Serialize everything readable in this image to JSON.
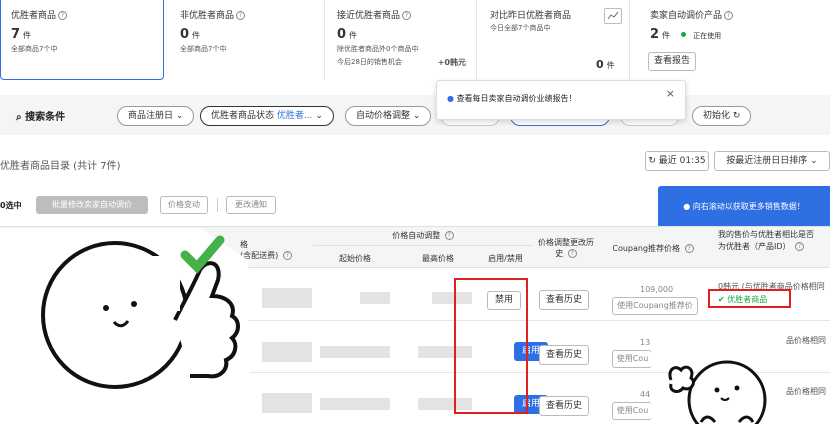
{
  "cards": [
    {
      "title": "优胜者商品",
      "value": "7",
      "unit": "件",
      "sub1": "全部商品7个中",
      "sub2": ""
    },
    {
      "title": "非优胜者商品",
      "value": "0",
      "unit": "件",
      "sub1": "全部商品7个中",
      "sub2": ""
    },
    {
      "title": "接近优胜者商品",
      "value": "0",
      "unit": "件",
      "sub1": "除优胜者商品外0个商品中",
      "sub2": "今后28日的销售机会",
      "extra": "+0韩元"
    },
    {
      "title": "对比昨日优胜者商品",
      "value": "0",
      "unit": "件",
      "sub1": "今日全部7个商品中"
    },
    {
      "title": "卖家自动调价产品",
      "value": "2",
      "unit": "件",
      "status": "正在使用",
      "button": "查看报告"
    }
  ],
  "tooltip": {
    "text": "查看每日卖家自动调价业绩报告！",
    "close": "×"
  },
  "filters": {
    "label": "搜索条件",
    "pills": [
      "商品注册日",
      "优胜者商品状态",
      "优胜者...",
      "自动价格调整"
    ],
    "reset": "初始化"
  },
  "list": {
    "title": "优胜者商品目录 (共计 7件)",
    "refresh": "最近 01:35",
    "sort": "按最近注册日日排序"
  },
  "toolbar": {
    "selected": "0选中",
    "batch": "批量修改卖家自动调价",
    "price_change": "价格变动",
    "notify": "更改通知",
    "banner": "向右滚动以获取更多销售数据！"
  },
  "table": {
    "col_price_partial": "格",
    "col_price_partial2": "(含配送费)",
    "group_auto": "价格自动调整",
    "col_start": "起始价格",
    "col_max": "最高价格",
    "col_toggle": "启用/禁用",
    "col_history": "价格调整更改历史",
    "col_coupang": "Coupang推荐价格",
    "col_winner": "我的售价与优胜者相比是否为优胜者（产品ID）",
    "rows": [
      {
        "toggle": "禁用",
        "history": "查看历史",
        "coupang_price": "109,000",
        "coupang_btn": "使用Coupang推荐价",
        "winner_text": "0韩元 (与优胜者商品价格相同",
        "badge": "优胜者商品"
      },
      {
        "toggle": "启用",
        "history": "查看历史",
        "coupang_price": "13",
        "coupang_btn": "使用Cou",
        "winner_text": "品价格相同"
      },
      {
        "toggle": "启用",
        "history": "查看历史",
        "coupang_price": "44",
        "coupang_btn": "使用Cou",
        "winner_text": "品价格相同"
      }
    ]
  },
  "colors": {
    "accent": "#2f6fe4",
    "highlight": "#e02020",
    "success": "#1aa64a"
  }
}
